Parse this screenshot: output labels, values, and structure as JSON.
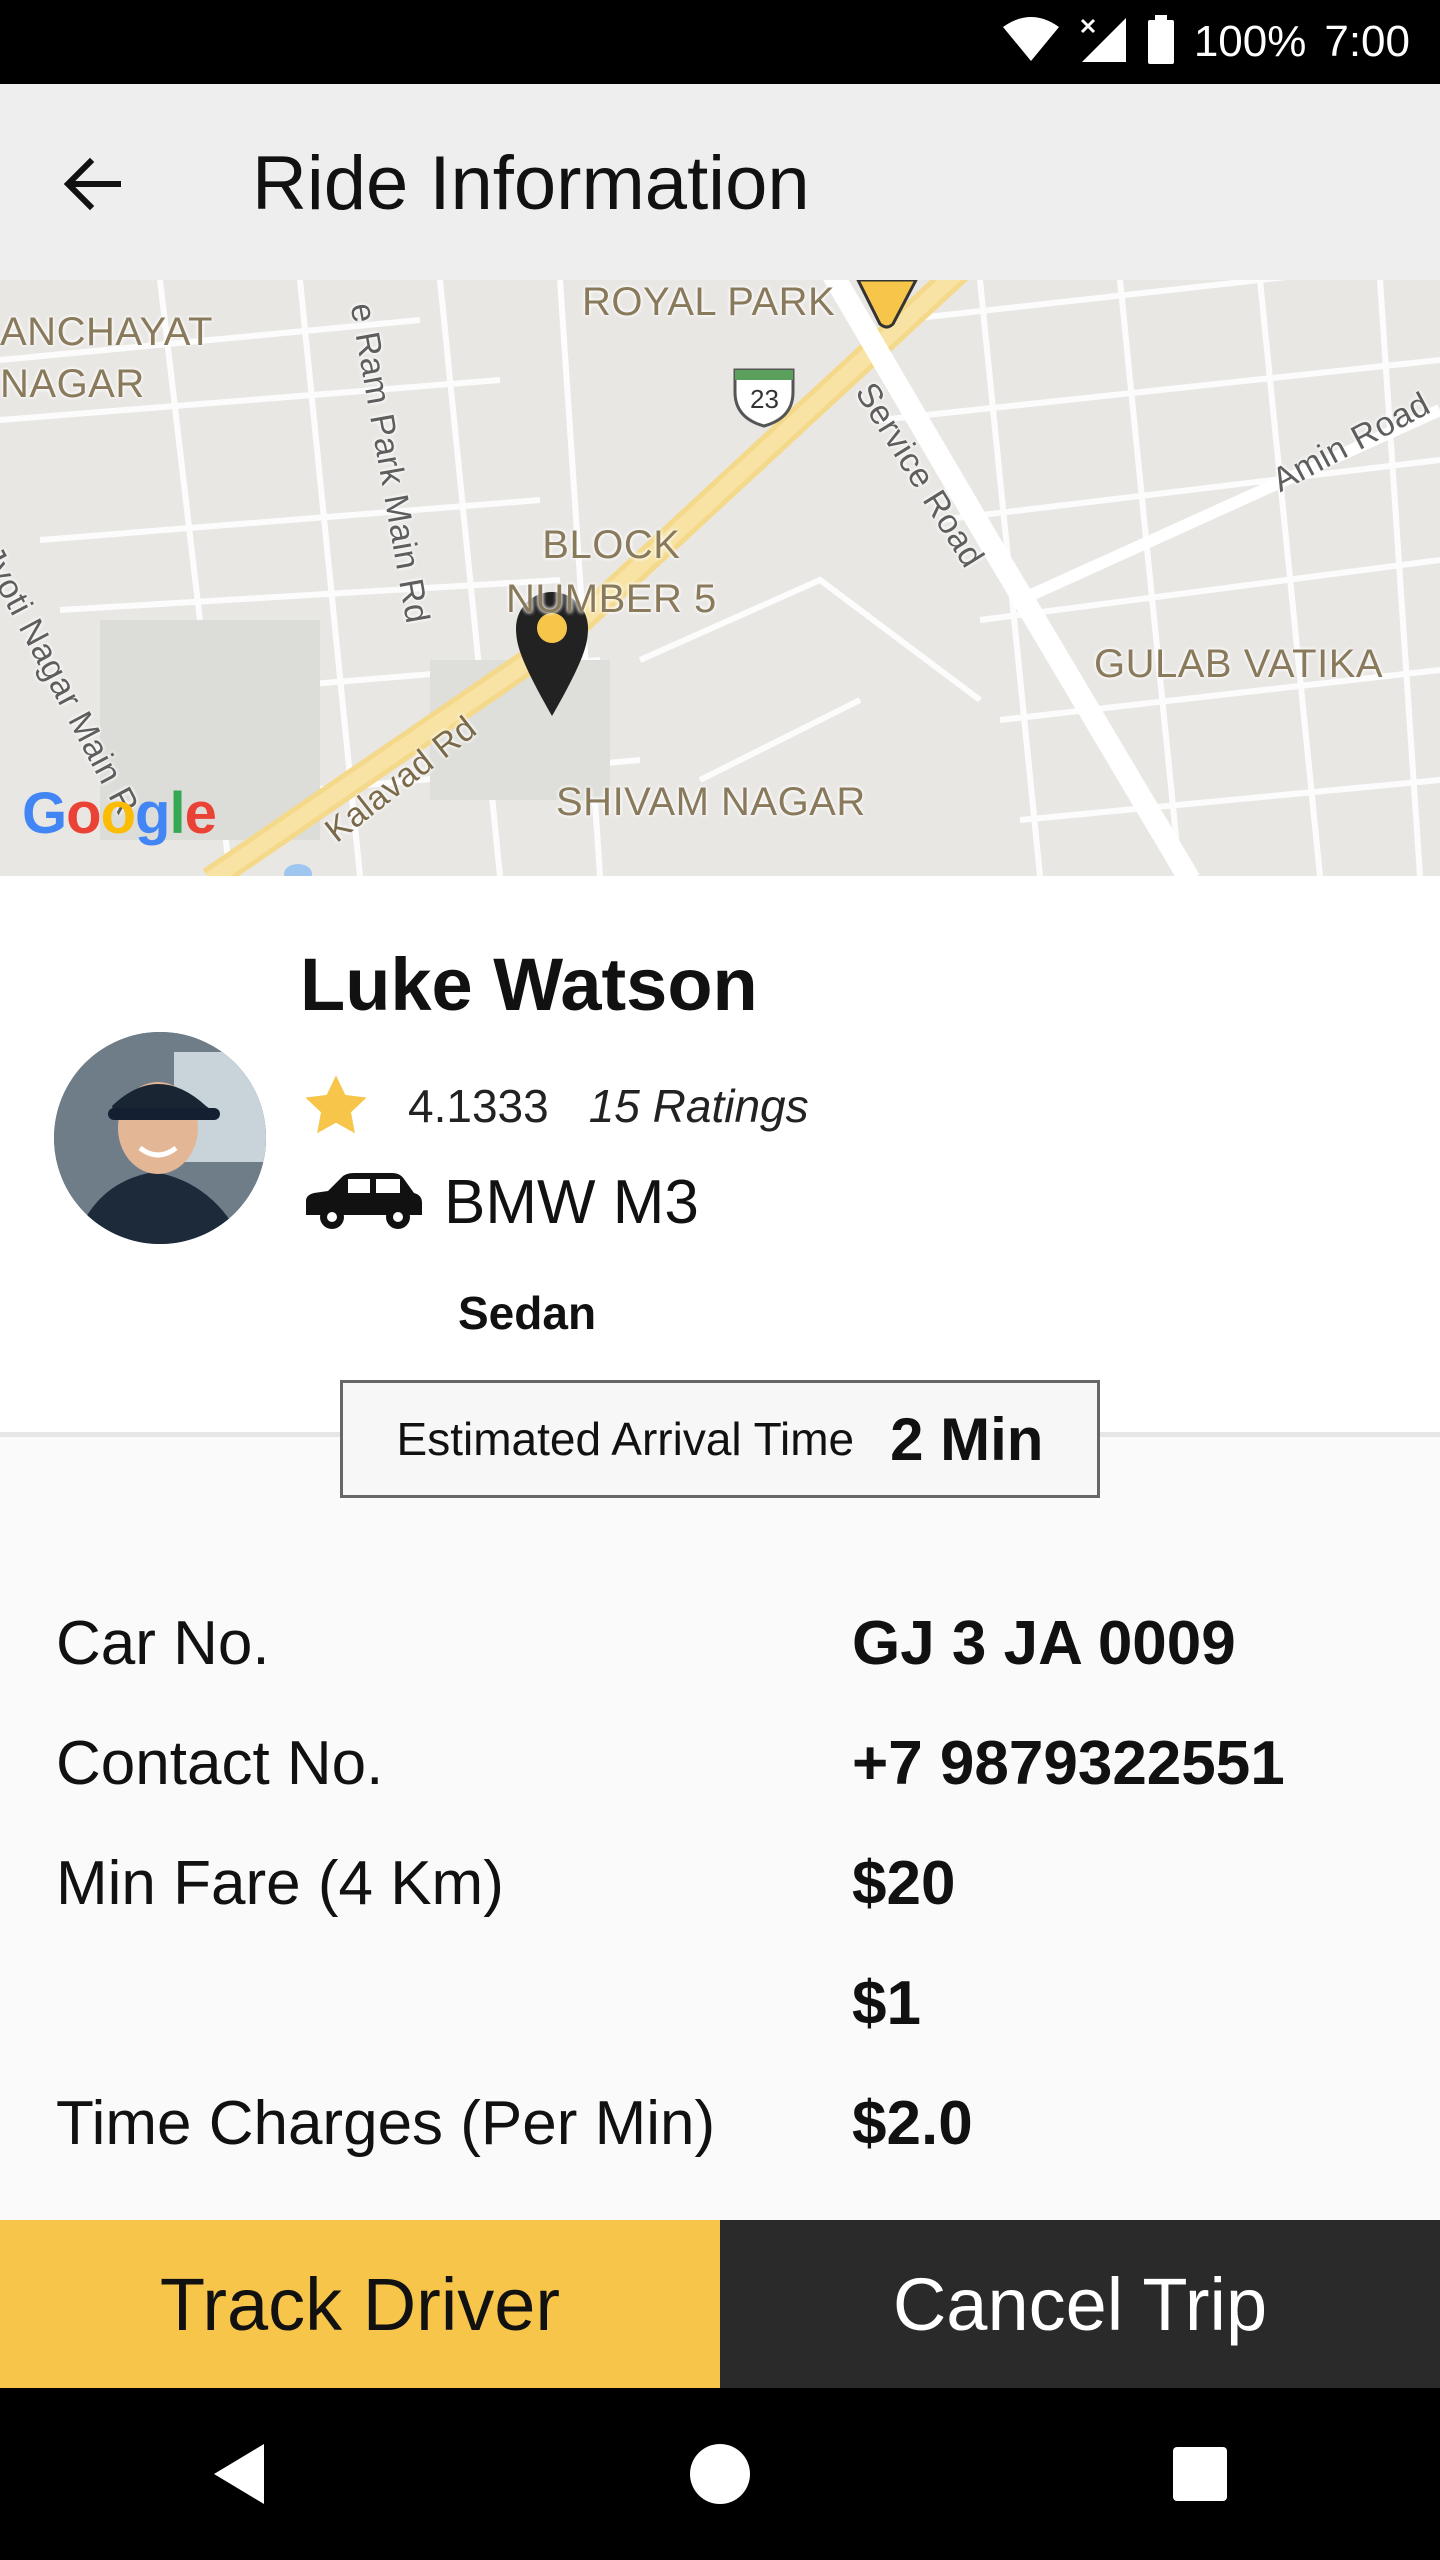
{
  "status_bar": {
    "battery_text": "100%",
    "time": "7:00"
  },
  "app_bar": {
    "title": "Ride Information",
    "back_icon": "arrow-left-icon"
  },
  "map": {
    "labels": {
      "panchayat": "ANCHAYAT\nNAGAR",
      "royal_park": "ROYAL PARK",
      "ram_park": "e Ram Park Main Rd",
      "block": "BLOCK\nNUMBER 5",
      "service_road": "Service Road",
      "amin_road": "Amin Road",
      "jyoti": "Jyoti Nagar Main R",
      "gulab": "GULAB VATIKA",
      "kalavad": "Kalavad Rd",
      "shivam": "SHIVAM NAGAR",
      "route": "23"
    },
    "attribution": "Google"
  },
  "driver": {
    "name": "Luke Watson",
    "rating": "4.1333",
    "rating_count": "15 Ratings",
    "car_model": "BMW M3",
    "car_type": "Sedan"
  },
  "eta": {
    "label": "Estimated Arrival Time",
    "value": "2 Min"
  },
  "details": [
    {
      "label": "Car No.",
      "value": "GJ 3 JA 0009"
    },
    {
      "label": "Contact No.",
      "value": "+7 9879322551"
    },
    {
      "label": "Min Fare (4 Km)",
      "value": "$20"
    },
    {
      "label": "",
      "value": "$1"
    },
    {
      "label": "Time Charges (Per Min)",
      "value": "$2.0"
    }
  ],
  "buttons": {
    "track": "Track Driver",
    "cancel": "Cancel Trip"
  },
  "colors": {
    "accent": "#f6c54a",
    "dark": "#2a2a2a"
  }
}
